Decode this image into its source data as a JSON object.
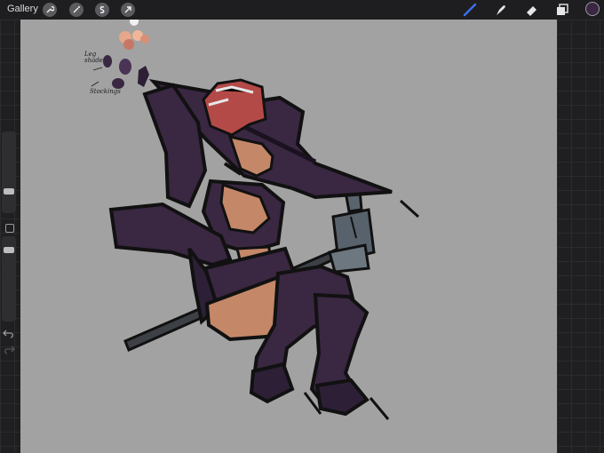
{
  "topbar": {
    "gallery_label": "Gallery",
    "left_tools": [
      {
        "name": "actions-wrench-icon"
      },
      {
        "name": "adjustments-wand-icon"
      },
      {
        "name": "selection-s-icon"
      },
      {
        "name": "transform-arrow-icon"
      }
    ],
    "right_tools": [
      {
        "name": "brush-icon",
        "active": true,
        "color": "#3b6ff0"
      },
      {
        "name": "smudge-icon"
      },
      {
        "name": "eraser-icon"
      },
      {
        "name": "layers-icon"
      }
    ],
    "current_color": "#3a2742"
  },
  "sidebar": {
    "brush_size_level": 0.45,
    "opacity_level": 0.2,
    "buttons": [
      "modify-button",
      "undo-icon",
      "redo-icon"
    ]
  },
  "canvas": {
    "background": "#a2a2a2",
    "notes": {
      "line1": "Leg",
      "line2": "shade",
      "line3": "Stockings"
    },
    "palette": [
      "#f0f0f0",
      "#e6a78c",
      "#d88f74",
      "#c67766",
      "#f0b699",
      "#3a2742",
      "#4a3456",
      "#2c1f36"
    ]
  }
}
